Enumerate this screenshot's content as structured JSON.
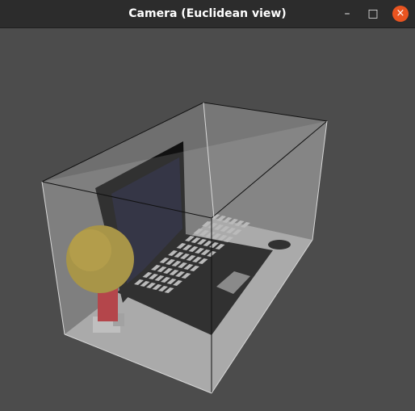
{
  "window": {
    "title": "Camera (Euclidean view)",
    "controls": {
      "minimize_glyph": "–",
      "maximize_glyph": "□",
      "close_glyph": "×"
    },
    "close_color": "#e95420",
    "background_color": "#4c4c4c"
  },
  "scene": {
    "objects": [
      "transparent-box",
      "laptop",
      "keyboard",
      "touchpad",
      "mouse",
      "yellow-ball-on-stand"
    ]
  }
}
